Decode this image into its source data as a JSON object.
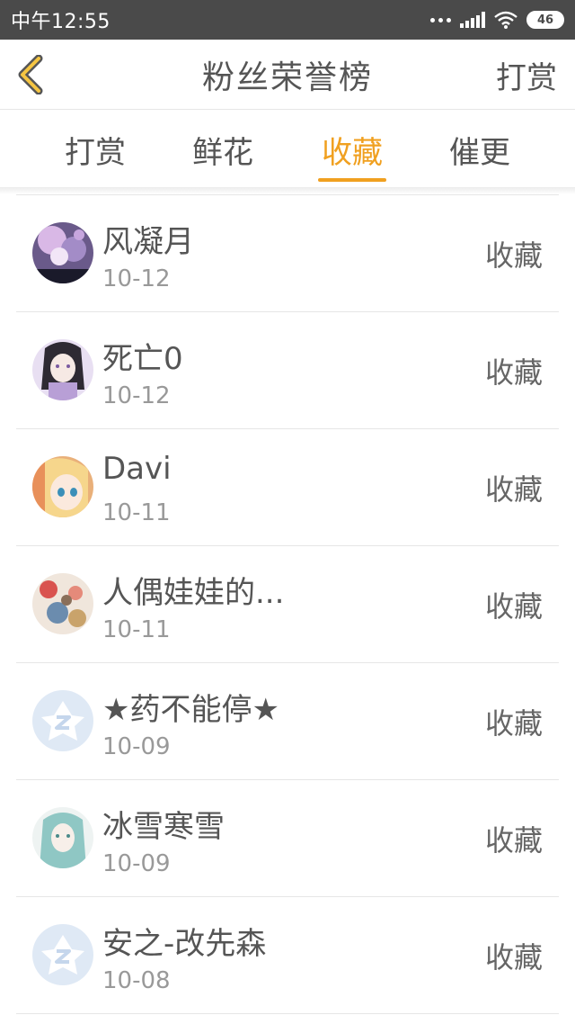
{
  "status_bar": {
    "time": "中午12:55",
    "battery": "46"
  },
  "header": {
    "title": "粉丝荣誉榜",
    "action_label": "打赏",
    "accent_color": "#f0a020"
  },
  "tabs": [
    {
      "label": "打赏",
      "active": false
    },
    {
      "label": "鲜花",
      "active": false
    },
    {
      "label": "收藏",
      "active": true
    },
    {
      "label": "催更",
      "active": false
    }
  ],
  "fans": [
    {
      "name": "风凝月",
      "date": "10-12",
      "action": "收藏",
      "avatar": "anime-avatar-purple"
    },
    {
      "name": "死亡0",
      "date": "10-12",
      "action": "收藏",
      "avatar": "anime-avatar-girl"
    },
    {
      "name": "Davi",
      "date": "10-11",
      "action": "收藏",
      "avatar": "anime-avatar-blonde"
    },
    {
      "name": "人偶娃娃的...",
      "date": "10-11",
      "action": "收藏",
      "avatar": "anime-avatar-floral"
    },
    {
      "name": "★药不能停★",
      "date": "10-09",
      "action": "收藏",
      "avatar": "default-qq-avatar"
    },
    {
      "name": "冰雪寒雪",
      "date": "10-09",
      "action": "收藏",
      "avatar": "anime-avatar-teal"
    },
    {
      "name": "安之-改先森",
      "date": "10-08",
      "action": "收藏",
      "avatar": "default-qq-avatar"
    }
  ]
}
